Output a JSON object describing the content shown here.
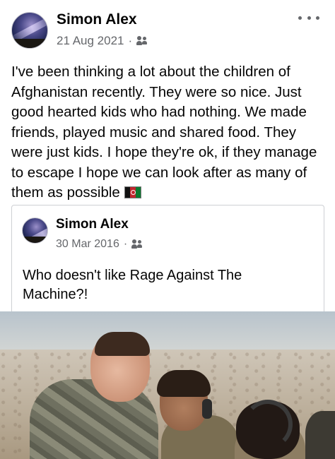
{
  "post": {
    "author": "Simon Alex",
    "date": "21 Aug 2021",
    "separator": "·",
    "audience_icon": "friends-icon",
    "more_icon": "more-options-icon",
    "text_lines": [
      "I've been thinking a lot about the children of",
      "Afghanistan recently. They were so nice. Just",
      "good hearted kids who had nothing.  We made",
      "friends, played music and shared food. They",
      "were just kids. I hope they're ok, if they manage",
      "to escape I hope we can look after as many of",
      "them as possible"
    ],
    "flag_emoji": "afghanistan-flag-icon"
  },
  "shared_post": {
    "author": "Simon Alex",
    "date": "30 Mar 2016",
    "separator": "·",
    "audience_icon": "friends-icon",
    "text_lines": [
      "Who doesn't like Rage Against The",
      "Machine?!"
    ]
  },
  "colors": {
    "text": "#050505",
    "secondary": "#65676b",
    "border": "#ced0d4"
  }
}
